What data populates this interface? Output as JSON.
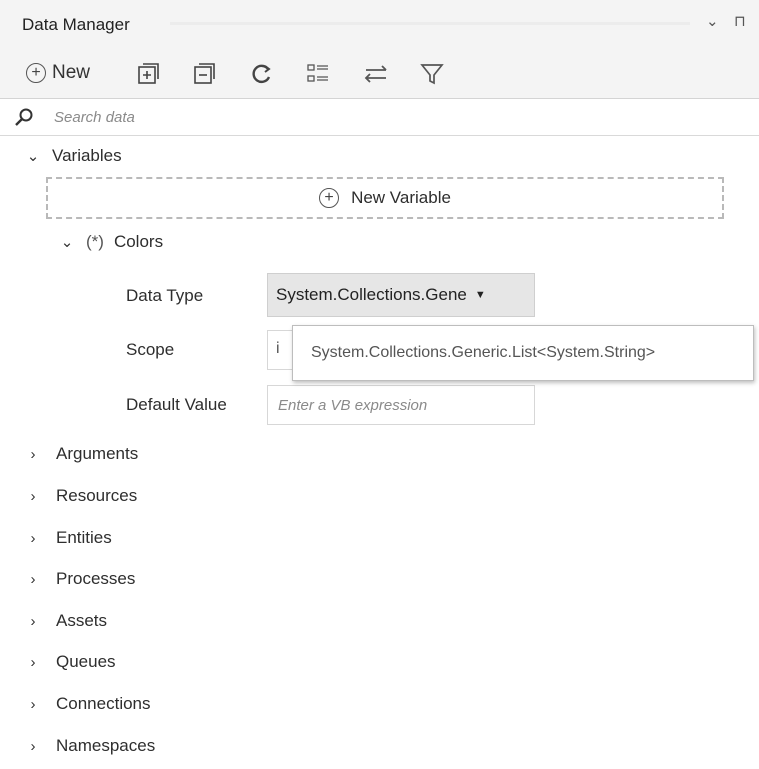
{
  "panel": {
    "title": "Data Manager",
    "controls": [
      "⌄",
      "⊓"
    ]
  },
  "toolbar": {
    "new_label": "New",
    "icons": [
      "add-icon",
      "expand-all-icon",
      "collapse-all-icon",
      "refresh-icon",
      "list-view-icon",
      "sort-icon",
      "filter-icon"
    ]
  },
  "search": {
    "placeholder": "Search data"
  },
  "tree": {
    "variables_label": "Variables",
    "new_variable_label": "New Variable",
    "variable": {
      "prefix": "(*)",
      "name": "Colors",
      "data_type_label": "Data Type",
      "data_type_value": "System.Collections.Gene",
      "scope_label": "Scope",
      "scope_value": "i",
      "default_label": "Default Value",
      "default_placeholder": "Enter a VB expression"
    },
    "dropdown_option": "System.Collections.Generic.List<System.String>",
    "sections": [
      "Arguments",
      "Resources",
      "Entities",
      "Processes",
      "Assets",
      "Queues",
      "Connections",
      "Namespaces"
    ]
  },
  "colors": {
    "toolbar_bg": "#f4f4f4",
    "select_bg": "#e6e6e6",
    "border": "#d4d4d4"
  }
}
